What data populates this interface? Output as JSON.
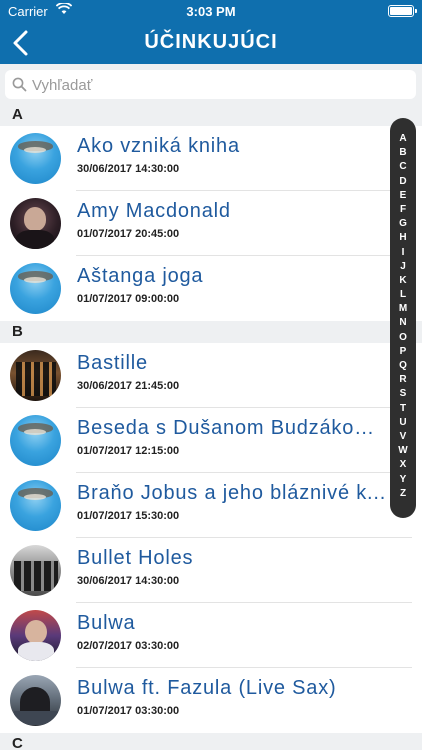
{
  "status_bar": {
    "carrier": "Carrier",
    "time": "3:03 PM"
  },
  "nav": {
    "title": "ÚČINKUJÚCI"
  },
  "search": {
    "placeholder": "Vyhľadať"
  },
  "sections": [
    {
      "letter": "A",
      "items": [
        {
          "title": "Ako vzniká kniha",
          "datetime": "30/06/2017 14:30:00",
          "avatar": "logo"
        },
        {
          "title": "Amy Macdonald",
          "datetime": "01/07/2017 20:45:00",
          "avatar": "photo"
        },
        {
          "title": "Aštanga joga",
          "datetime": "01/07/2017 09:00:00",
          "avatar": "logo"
        }
      ]
    },
    {
      "letter": "B",
      "items": [
        {
          "title": "Bastille",
          "datetime": "30/06/2017 21:45:00",
          "avatar": "photo"
        },
        {
          "title": "Beseda s Dušanom Budzákom ...",
          "datetime": "01/07/2017 12:15:00",
          "avatar": "logo"
        },
        {
          "title": "Braňo Jobus a jeho bláznivé k...",
          "datetime": "01/07/2017 15:30:00",
          "avatar": "logo"
        },
        {
          "title": "Bullet Holes",
          "datetime": "30/06/2017 14:30:00",
          "avatar": "photo"
        },
        {
          "title": "Bulwa",
          "datetime": "02/07/2017 03:30:00",
          "avatar": "photo"
        },
        {
          "title": "Bulwa ft. Fazula (Live Sax)",
          "datetime": "01/07/2017 03:30:00",
          "avatar": "photo"
        }
      ]
    },
    {
      "letter": "C",
      "items": []
    }
  ],
  "index_letters": [
    "A",
    "B",
    "C",
    "D",
    "E",
    "F",
    "G",
    "H",
    "I",
    "J",
    "K",
    "L",
    "M",
    "N",
    "O",
    "P",
    "Q",
    "R",
    "S",
    "T",
    "U",
    "V",
    "W",
    "X",
    "Y",
    "Z"
  ],
  "colors": {
    "header": "#0f6fae",
    "title": "#1f5a9e",
    "index_bar": "#2f2f2f"
  }
}
